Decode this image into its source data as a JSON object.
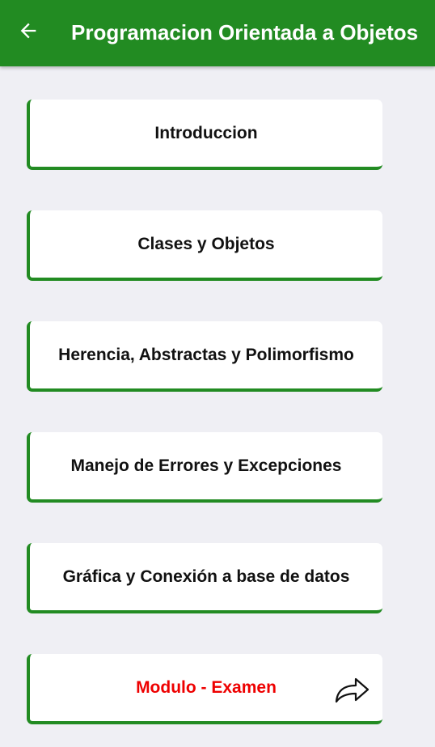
{
  "app_bar": {
    "title": "Programacion Orientada a Objetos",
    "back_icon": "arrow-left-icon",
    "background_color": "#228b22",
    "title_color": "#ffffff"
  },
  "menu": {
    "items": [
      {
        "label": "Introduccion"
      },
      {
        "label": "Clases y Objetos"
      },
      {
        "label": "Herencia, Abstractas y Polimorfismo"
      },
      {
        "label": "Manejo de Errores y Excepciones"
      },
      {
        "label": "Gráfica y Conexión a base de datos"
      },
      {
        "label": "Modulo - Examen",
        "icon": "share-forward-icon",
        "label_color": "#ee0000"
      }
    ],
    "accent_color": "#228b22"
  }
}
